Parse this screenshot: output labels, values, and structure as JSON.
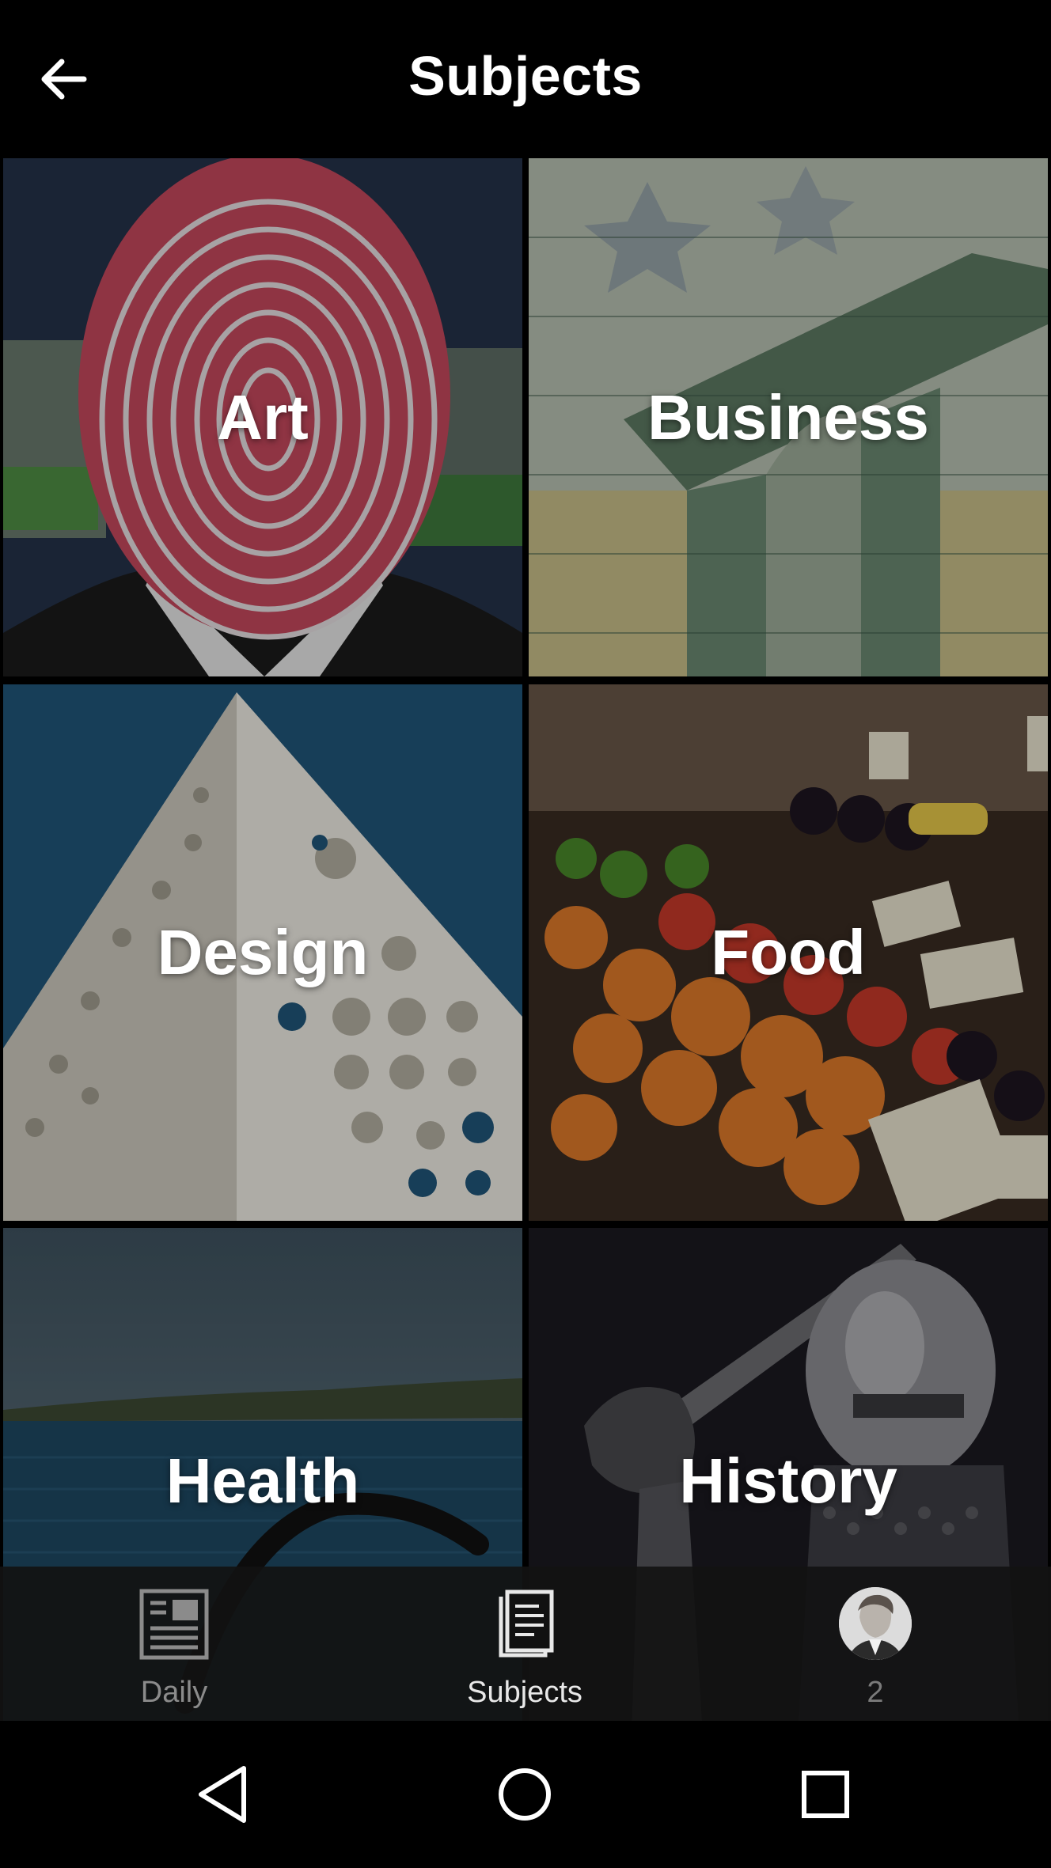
{
  "header": {
    "title": "Subjects",
    "back_icon": "arrow-left-icon"
  },
  "subjects": [
    {
      "label": "Art"
    },
    {
      "label": "Business"
    },
    {
      "label": "Design"
    },
    {
      "label": "Food"
    },
    {
      "label": "Health"
    },
    {
      "label": "History"
    }
  ],
  "tabbar": {
    "daily": {
      "label": "Daily",
      "icon": "newspaper-icon"
    },
    "subjects": {
      "label": "Subjects",
      "icon": "book-icon",
      "selected": true
    },
    "profile": {
      "label": "2",
      "icon": "avatar"
    }
  },
  "system_nav": {
    "back": "triangle-back-icon",
    "home": "circle-home-icon",
    "recent": "square-recents-icon"
  }
}
